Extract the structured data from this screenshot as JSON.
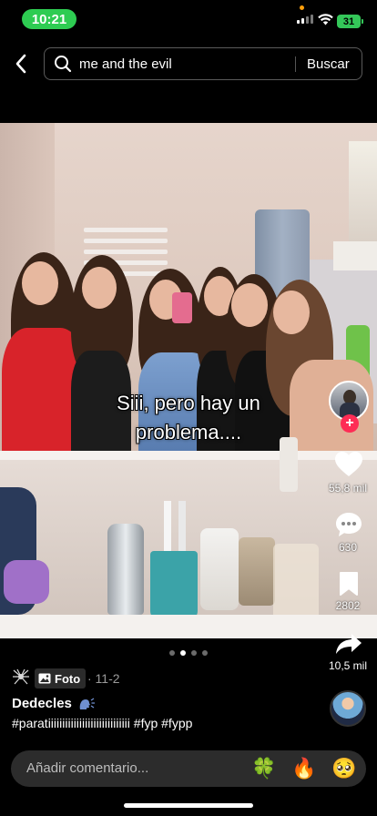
{
  "status_bar": {
    "time": "10:21",
    "battery": "31"
  },
  "search": {
    "query": "me and the evil",
    "button_label": "Buscar"
  },
  "post": {
    "caption_lines": [
      "Siii, pero hay un",
      "problema...."
    ],
    "carousel": {
      "count": 4,
      "active_index": 1
    }
  },
  "actions": {
    "likes": "55,8 mil",
    "comments": "630",
    "saves": "2802",
    "shares": "10,5 mil"
  },
  "meta": {
    "type_label": "Foto",
    "date": "· 11-2",
    "author": "Dedecles",
    "hashtags": "#paratiiiiiiiiiiiiiiiiiiiiiiiiiiiii #fyp #fypp"
  },
  "comment_bar": {
    "placeholder": "Añadir comentario...",
    "emojis": [
      "🍀",
      "🔥",
      "🥺"
    ]
  },
  "colors": {
    "accent": "#fe2c55",
    "status_green": "#2ecc52",
    "battery_green": "#34c759"
  }
}
